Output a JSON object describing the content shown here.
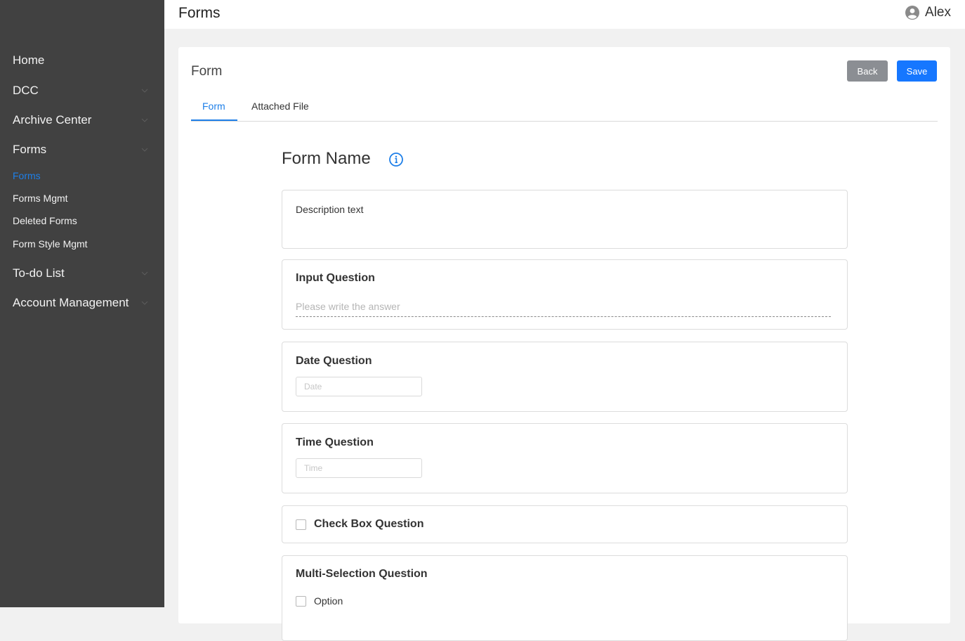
{
  "header": {
    "title": "Forms",
    "user_name": "Alex",
    "user_icon": "user-circle-icon"
  },
  "sidebar": {
    "items": [
      {
        "label": "Home",
        "has_chevron": false
      },
      {
        "label": "DCC",
        "has_chevron": true
      },
      {
        "label": "Archive Center",
        "has_chevron": true
      },
      {
        "label": "Forms",
        "has_chevron": true,
        "expanded": true
      }
    ],
    "sub_items": [
      {
        "label": "Forms",
        "active": true
      },
      {
        "label": "Forms Mgmt",
        "active": false
      },
      {
        "label": "Deleted Forms",
        "active": false
      },
      {
        "label": "Form Style Mgmt",
        "active": false
      }
    ],
    "items_after": [
      {
        "label": "To-do List",
        "has_chevron": true
      },
      {
        "label": "Account Management",
        "has_chevron": true
      }
    ]
  },
  "card": {
    "title": "Form",
    "back_label": "Back",
    "save_label": "Save",
    "tabs": [
      {
        "label": "Form",
        "active": true
      },
      {
        "label": "Attached File",
        "active": false
      }
    ]
  },
  "form": {
    "name": "Form Name",
    "info_icon": "info-circle-icon",
    "description": "Description text",
    "input_question": {
      "title": "Input Question",
      "placeholder": "Please write the answer"
    },
    "date_question": {
      "title": "Date Question",
      "placeholder": "Date"
    },
    "time_question": {
      "title": "Time Question",
      "placeholder": "Time"
    },
    "checkbox_question": {
      "title": "Check Box Question"
    },
    "multi_question": {
      "title": "Multi-Selection Question",
      "options": [
        "Option"
      ]
    }
  },
  "colors": {
    "sidebar_bg": "#414141",
    "accent": "#1e7fe8",
    "save_button": "#1677ff",
    "back_button": "#8b8e93",
    "page_bg": "#f1f1f1"
  }
}
